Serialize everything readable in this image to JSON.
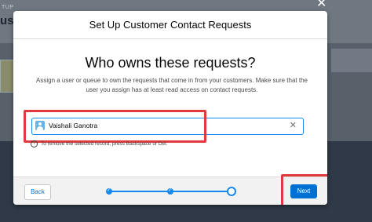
{
  "background": {
    "setup_label": "TUP",
    "page_title": "ust"
  },
  "modal": {
    "title": "Set Up Customer Contact Requests",
    "question": "Who owns these requests?",
    "description": "Assign a user or queue to own the requests that come in from your customers. Make sure that the user you assign has at least read access on contact requests.",
    "owner_field": {
      "value": "Vaishali Ganotra",
      "icon": "user-icon",
      "clear_icon": "close-icon"
    },
    "hint": "To remove the selected record, press Backspace or Del.",
    "footer": {
      "back_label": "Back",
      "next_label": "Next",
      "progress": {
        "steps": 3,
        "current_step": 3
      }
    }
  },
  "colors": {
    "brand": "#0070d2",
    "highlight": "#e03a3e"
  }
}
